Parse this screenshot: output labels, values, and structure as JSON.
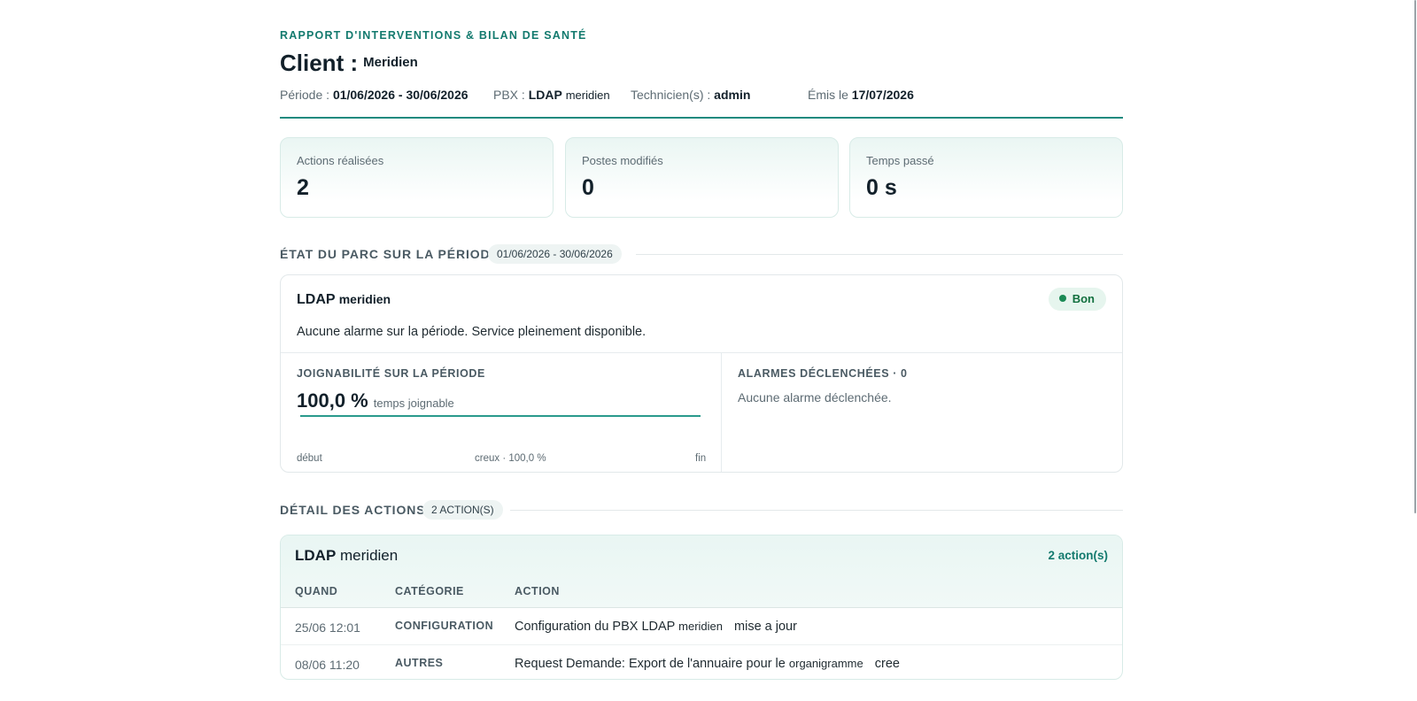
{
  "report": {
    "eyebrow": "RAPPORT D'INTERVENTIONS & BILAN DE SANTÉ",
    "client_label": "Client :",
    "client_name": "Meridien"
  },
  "meta": {
    "period_label": "Période :",
    "period_value": "01/06/2026 - 30/06/2026",
    "pbx_label": "PBX :",
    "pbx_value_main": "LDAP",
    "pbx_value_sub": "meridien",
    "tech_label": "Technicien(s) :",
    "tech_value": "admin",
    "issued_label": "Émis le",
    "issued_value": "17/07/2026"
  },
  "kpis": [
    {
      "label": "Actions réalisées",
      "value": "2"
    },
    {
      "label": "Postes modifiés",
      "value": "0"
    },
    {
      "label": "Temps passé",
      "value": "0 s"
    }
  ],
  "parc": {
    "title": "ÉTAT DU PARC SUR LA PÉRIODE",
    "chip": "01/06/2026 - 30/06/2026",
    "service_main": "LDAP",
    "service_sub": "meridien",
    "status": "Bon",
    "message": "Aucune alarme sur la période. Service pleinement disponible.",
    "reach_label": "JOIGNABILITÉ SUR LA PÉRIODE",
    "reach_value": "100,0 %",
    "reach_unit": "temps joignable",
    "reach_percent": 100.0,
    "axis_start": "début",
    "axis_mid": "creux · 100,0 %",
    "axis_end": "fin",
    "alarms_label": "ALARMES DÉCLENCHÉES · 0",
    "alarms_note": "Aucune alarme déclenchée."
  },
  "details": {
    "title": "DÉTAIL DES ACTIONS",
    "chip": "2 ACTION(S)",
    "service_main": "LDAP",
    "service_sub": "meridien",
    "count": "2 action(s)",
    "columns": [
      "QUAND",
      "CATÉGORIE",
      "ACTION"
    ],
    "rows": [
      {
        "when": "25/06 12:01",
        "category": "CONFIGURATION",
        "action_main": "Configuration du PBX LDAP",
        "action_sub": "meridien",
        "action_status": "mise a jour"
      },
      {
        "when": "08/06 11:20",
        "category": "AUTRES",
        "action_main": "Request Demande: Export de l'annuaire pour le",
        "action_sub": "organigramme",
        "action_status": "cree"
      }
    ]
  },
  "colors": {
    "accent": "#137a6e",
    "status_ok": "#1a8a55",
    "border": "#e2e8ea"
  }
}
